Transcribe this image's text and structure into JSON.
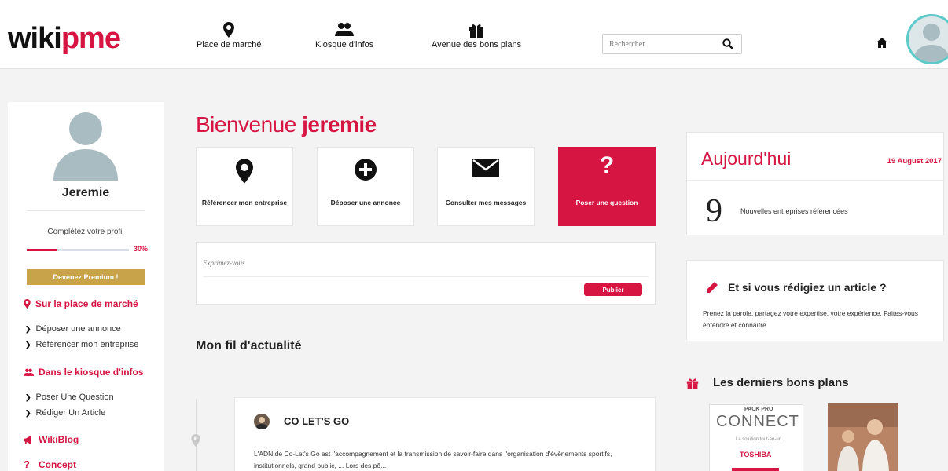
{
  "header": {
    "logo_w": "wikipme_w",
    "logo_prefix": "wiki",
    "logo_suffix": "pme",
    "nav": [
      {
        "label": "Place de marché",
        "icon": "map-pin-icon"
      },
      {
        "label": "Kiosque d'infos",
        "icon": "people-icon"
      },
      {
        "label": "Avenue des bons plans",
        "icon": "gift-icon"
      }
    ],
    "search_placeholder": "Rechercher"
  },
  "sidebar": {
    "user_name": "Jeremie",
    "profile_label": "Complétez votre profil",
    "profile_progress": 30,
    "profile_pct_label": "30%",
    "premium_label": "Devenez Premium !",
    "sections": [
      {
        "label": "Sur la place de marché",
        "icon": "map-pin-icon"
      },
      {
        "label": "Dans le kiosque d'infos",
        "icon": "people-icon"
      },
      {
        "label": "WikiBlog",
        "icon": "megaphone-icon"
      },
      {
        "label": "Concept",
        "icon": "question-icon"
      }
    ],
    "links_market": [
      "Déposer une annonce",
      "Référencer mon entreprise"
    ],
    "links_kiosk": [
      "Poser Une Question",
      "Rédiger Un Article"
    ]
  },
  "main": {
    "welcome_prefix": "Bienvenue",
    "welcome_user": "jeremie",
    "cards": [
      {
        "label": "Référencer mon entreprise",
        "icon": "map-pin-icon"
      },
      {
        "label": "Déposer une annonce",
        "icon": "plus-circle-icon"
      },
      {
        "label": "Consulter mes messages",
        "icon": "envelope-icon"
      },
      {
        "label": "Poser une question",
        "icon": "question-icon",
        "glyph": "?"
      }
    ],
    "post_placeholder": "Exprimez-vous",
    "publish_label": "Publier",
    "feed_title": "Mon fil d'actualité",
    "feed_item": {
      "name": "CO LET'S GO",
      "text": "L'ADN de Co-Let's Go est l'accompagnement et la transmission de savoir-faire dans l'organisation d'évènements sportifs, institutionnels, grand public, ... Lors des pô..."
    }
  },
  "right": {
    "today_title": "Aujourd'hui",
    "today_date": "19 August 2017",
    "today_count": "9",
    "today_desc": "Nouvelles entreprises référencées",
    "article_title": "Et si vous rédigiez un article ?",
    "article_text": "Prenez la parole, partagez votre expertise, votre expérience. Faites-vous entendre et connaître",
    "deals_title": "Les derniers bons plans",
    "deal1_brand": "PACK PRO",
    "deal1_title": "CONNECT",
    "deal1_sub": "La solution tout-en-un",
    "deal1_partner": "TOSHIBA"
  },
  "colors": {
    "accent": "#d61543",
    "gold": "#c9a34a",
    "avatar_ring": "#5ec9c9"
  }
}
